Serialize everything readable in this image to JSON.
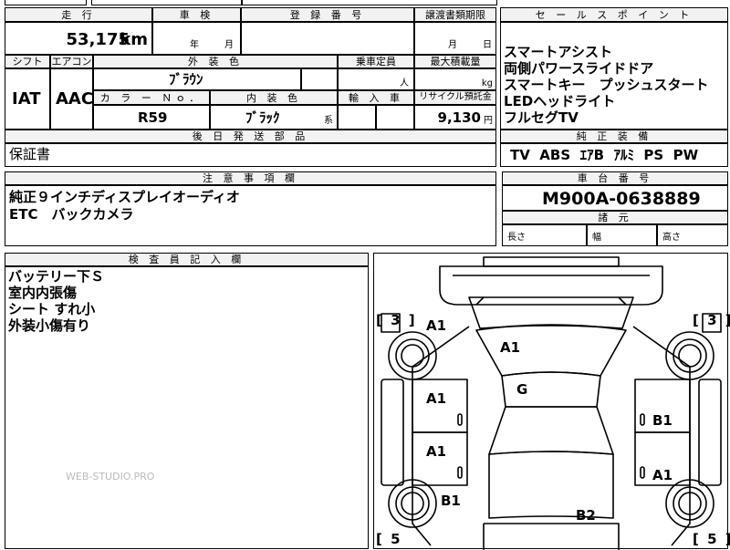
{
  "headers": {
    "mileage": "走 行",
    "inspection": "車 検",
    "registration": "登 録 番 号",
    "transfer_deadline": "譲渡書類期限",
    "sales_points": "セ ー ル ス ポ イ ン ト",
    "shift": "シフト",
    "aircon": "エアコン",
    "exterior_color": "外 装 色",
    "capacity": "乗車定員",
    "max_load": "最大積載量",
    "color_no": "カ ラ ー Ｎｏ．",
    "interior_color": "内 装 色",
    "import": "輸 入 車",
    "recycle": "リサイクル預託金",
    "later_parts": "後 日 発 送 部 品",
    "standard_equipment": "純 正 装 備",
    "notes": "注 意 事 項 欄",
    "chassis_no": "車 台 番 号",
    "specs": "諸 元",
    "inspector": "検 査 員 記 入 欄"
  },
  "values": {
    "mileage": "53,175",
    "mileage_unit": "km",
    "inspection_year": "年",
    "inspection_month": "月",
    "transfer_month": "月",
    "transfer_day": "日",
    "shift": "IAT",
    "aircon": "AAC",
    "exterior_color": "ﾌﾞﾗｳﾝ",
    "capacity_unit": "人",
    "max_load_unit": "kg",
    "color_no": "R59",
    "interior_color": "ﾌﾞﾗｯｸ",
    "interior_suffix": "系",
    "recycle": "9,130",
    "recycle_unit": "円",
    "later_parts": "保証書",
    "standard_equipment": "TV  ABS  ｴｱB  ｱﾙﾐ  PS  PW",
    "chassis_no": "M900A-0638889",
    "length_label": "長さ",
    "width_label": "幅",
    "height_label": "高さ"
  },
  "sales_points": [
    "スマートアシスト",
    "両側パワースライドドア",
    "スマートキー　プッシュスタート",
    "LEDヘッドライト",
    "フルセグTV"
  ],
  "notes": [
    "純正９インチディスプレイオーディオ",
    "ETC　バックカメラ"
  ],
  "inspector_notes": [
    "バッテリー下Ｓ",
    "室内内張傷",
    "シート すれ小",
    "外装小傷有り"
  ],
  "diagram": {
    "tire_front_left": "[ 3 ]",
    "tire_front_right": "[ 3 ]",
    "tire_rear_left": "[ 5",
    "tire_rear_right": "[ 5 ]",
    "mark_front_left_fender": "A1",
    "mark_windshield": "A1",
    "mark_roof": "G",
    "mark_front_left_door": "A1",
    "mark_rear_left_door": "A1",
    "mark_rear_left_fender": "B1",
    "mark_right_front_door": "B1",
    "mark_right_rear_door": "A1",
    "mark_rear": "B2"
  },
  "watermark": "WEB-STUDIO.PRO"
}
